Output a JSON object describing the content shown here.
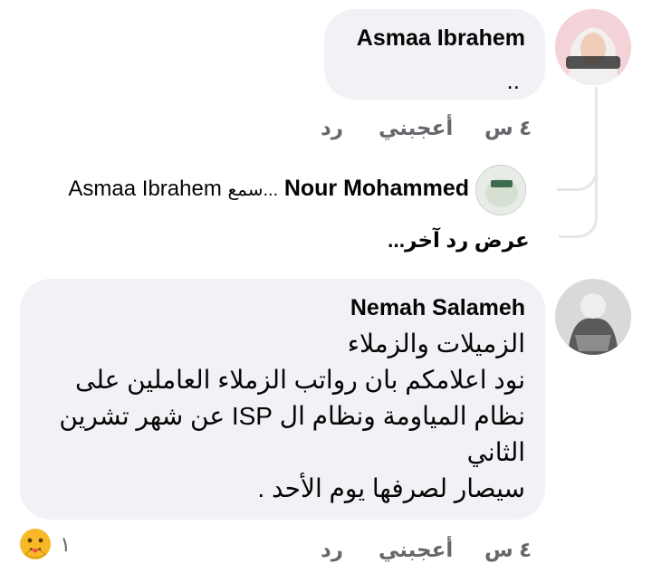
{
  "comments": [
    {
      "author": "Asmaa Ibrahem",
      "text": "..",
      "time": "٤ س",
      "like_label": "أعجبني",
      "reply_label": "رد"
    },
    {
      "author": "Nemah Salameh",
      "lines": [
        "الزميلات والزملاء",
        "نود اعلامكم بان  رواتب الزملاء  العاملين على",
        "نظام  المياومة ونظام ال ISP   عن شهر تشرين",
        "الثاني",
        "سيصار لصرفها يوم الأحد ."
      ],
      "time": "٤ س",
      "like_label": "أعجبني",
      "reply_label": "رد",
      "reaction_count": "١",
      "reaction_icon": "care-emoji-icon"
    }
  ],
  "reply": {
    "author": "Nour Mohammed",
    "snippet": "سمع...",
    "mention": "Asmaa Ibrahem"
  },
  "view_more": "عرض رد آخر...",
  "colors": {
    "bubble": "#f0f2f5",
    "thread": "#e4e6eb",
    "meta": "#65676b"
  }
}
